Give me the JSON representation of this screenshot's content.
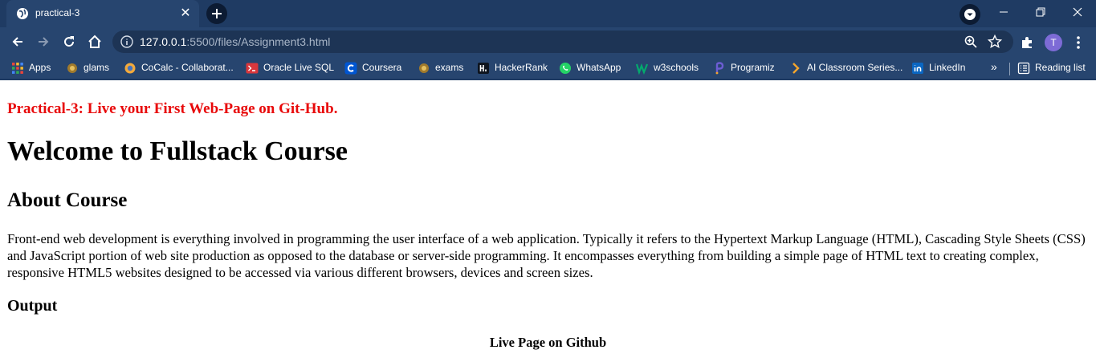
{
  "tab": {
    "title": "practical-3",
    "close_glyph": "✕"
  },
  "toolbar": {
    "url_host": "127.0.0.1",
    "url_rest": ":5500/files/Assignment3.html",
    "avatar_initial": "T"
  },
  "bookmarks": {
    "apps": "Apps",
    "glams": "glams",
    "cocalc": "CoCalc - Collaborat...",
    "oracle": "Oracle Live SQL",
    "coursera": "Coursera",
    "exams": "exams",
    "hackerrank": "HackerRank",
    "whatsapp": "WhatsApp",
    "w3schools": "w3schools",
    "programiz": "Programiz",
    "ai_classroom": "AI Classroom Series...",
    "linkedin": "LinkedIn",
    "more": "»",
    "reading_list": "Reading list"
  },
  "content": {
    "practical_heading": "Practical-3: Live your First Web-Page on Git-Hub.",
    "main_heading": "Welcome to Fullstack Course",
    "about_heading": "About Course",
    "about_paragraph": "Front-end web development is everything involved in programming the user interface of a web application. Typically it refers to the Hypertext Markup Language (HTML), Cascading Style Sheets (CSS) and JavaScript portion of web site production as opposed to the database or server-side programming. It encompasses everything from building a simple page of HTML text to creating complex, responsive HTML5 websites designed to be accessed via various different browsers, devices and screen sizes.",
    "output_heading": "Output",
    "live_page_label": "Live Page on Github"
  },
  "colors": {
    "tabstrip": "#1f3b63",
    "toolbar": "#27456f",
    "practical_heading": "#e8090a"
  },
  "icons": {
    "tab_favicon": "globe-icon",
    "new_tab": "plus-icon",
    "profile_menu": "chevron-down-icon",
    "back": "back-arrow-icon",
    "forward": "forward-arrow-icon",
    "reload": "reload-icon",
    "home": "home-icon",
    "site_info": "info-icon",
    "zoom": "zoom-icon",
    "bookmark": "star-icon",
    "extensions": "puzzle-icon",
    "menu": "kebab-menu-icon"
  }
}
